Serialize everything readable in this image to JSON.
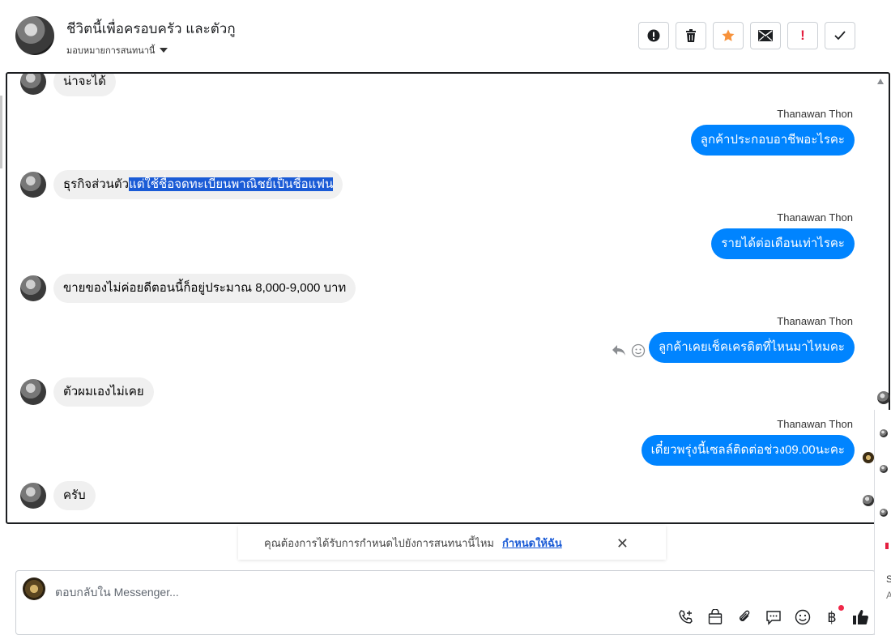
{
  "header": {
    "title": "ชีวิตนี้เพื่อครอบครัว และตัวกู",
    "assign_label": "มอบหมายการสนทนานี้"
  },
  "toolbar": {
    "buttons": [
      {
        "name": "report-spam-icon"
      },
      {
        "name": "trash-icon"
      },
      {
        "name": "star-icon"
      },
      {
        "name": "mail-icon"
      },
      {
        "name": "important-icon",
        "label": "!"
      },
      {
        "name": "check-icon"
      }
    ]
  },
  "messages": [
    {
      "dir": "in",
      "text": "น่าจะได้"
    },
    {
      "dir": "out",
      "sender": "Thanawan Thon",
      "text": "ลูกค้าประกอบอาชีพอะไรคะ"
    },
    {
      "dir": "in",
      "text_plain": "ธุรกิจส่วนตัว",
      "text_highlight": "แต่ใช้ชื่อจดทะเบียนพาณิชย์เป็นชื่อแฟน"
    },
    {
      "dir": "out",
      "sender": "Thanawan Thon",
      "text": "รายได้ต่อเดือนเท่าไรคะ"
    },
    {
      "dir": "in",
      "text": "ขายของไม่ค่อยดีตอนนี้ก็อยู่ประมาณ 8,000-9,000 บาท"
    },
    {
      "dir": "out",
      "sender": "Thanawan Thon",
      "text": "ลูกค้าเคยเช็คเครดิตที่ไหนมาไหมคะ"
    },
    {
      "dir": "in",
      "text": "ตัวผมเองไม่เคย"
    },
    {
      "dir": "out",
      "sender": "Thanawan Thon",
      "text": "เดี๋ยวพรุ่งนี้เซลล์ติดต่อช่วง09.00นะคะ"
    },
    {
      "dir": "in",
      "text": "ครับ"
    }
  ],
  "notice": {
    "text": "คุณต้องการได้รับการกำหนดไปยังการสนทนานี้ไหม",
    "link": "กำหนดให้ฉัน"
  },
  "composer": {
    "placeholder": "ตอบกลับใน Messenger...",
    "currency_icon": "฿"
  },
  "colors": {
    "accent": "#0084ff",
    "highlight": "#1a5bd6",
    "star": "#f7923b",
    "important": "#e41e3f"
  },
  "side_panel": {
    "fragments": [
      "S",
      "A"
    ]
  }
}
